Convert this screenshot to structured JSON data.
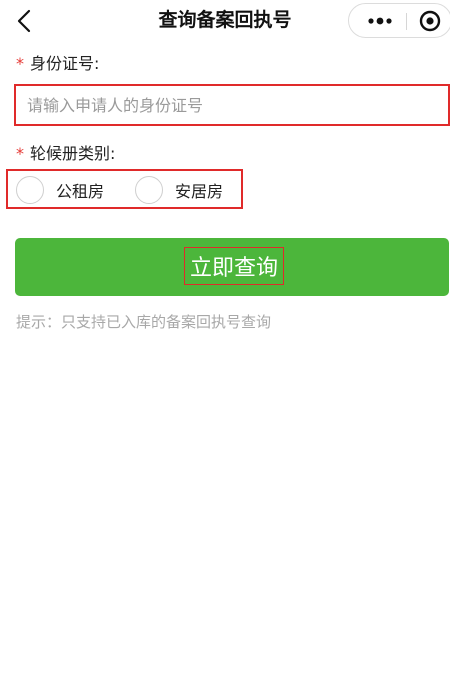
{
  "header": {
    "title": "查询备案回执号"
  },
  "form": {
    "id_label": "身份证号:",
    "required_mark": "*",
    "id_placeholder": "请输入申请人的身份证号",
    "id_value": "",
    "category_label": "轮候册类别:",
    "options": [
      {
        "label": "公租房",
        "selected": false
      },
      {
        "label": "安居房",
        "selected": false
      }
    ]
  },
  "actions": {
    "query_button_label": "立即查询"
  },
  "hint": "提示：只支持已入库的备案回执号查询",
  "colors": {
    "primary_button": "#4cb63b",
    "required": "#e53935",
    "highlight_border": "#e02a2a"
  }
}
